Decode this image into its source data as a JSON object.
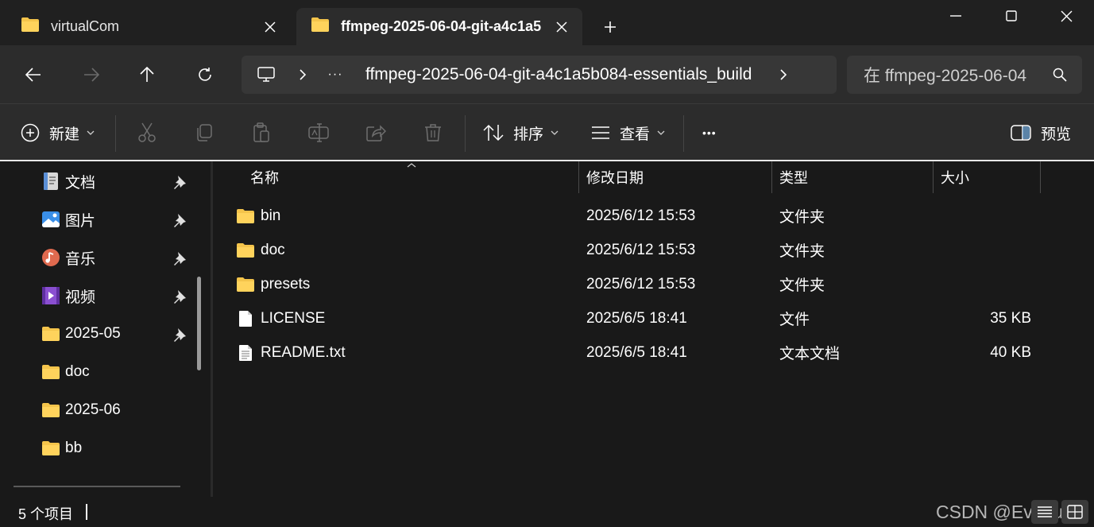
{
  "tabs": [
    {
      "title": "virtualCom",
      "active": false
    },
    {
      "title": "ffmpeg-2025-06-04-git-a4c1a5",
      "active": true
    }
  ],
  "address": {
    "path": "ffmpeg-2025-06-04-git-a4c1a5b084-essentials_build",
    "ellipsis": "···",
    "search_placeholder": "在 ffmpeg-2025-06-04"
  },
  "toolbar": {
    "new_label": "新建",
    "sort_label": "排序",
    "view_label": "查看",
    "more_label": "•••",
    "preview_label": "预览"
  },
  "sidebar": {
    "items": [
      {
        "label": "文档",
        "icon": "document-icon",
        "pinned": true
      },
      {
        "label": "图片",
        "icon": "picture-icon",
        "pinned": true
      },
      {
        "label": "音乐",
        "icon": "music-icon",
        "pinned": true
      },
      {
        "label": "视频",
        "icon": "video-icon",
        "pinned": true
      },
      {
        "label": "2025-05",
        "icon": "folder-icon",
        "pinned": true
      },
      {
        "label": "doc",
        "icon": "folder-icon",
        "pinned": false
      },
      {
        "label": "2025-06",
        "icon": "folder-icon",
        "pinned": false
      },
      {
        "label": "bb",
        "icon": "folder-icon",
        "pinned": false
      }
    ]
  },
  "columns": {
    "name": "名称",
    "modified": "修改日期",
    "type": "类型",
    "size": "大小"
  },
  "files": [
    {
      "name": "bin",
      "modified": "2025/6/12 15:53",
      "type": "文件夹",
      "size": "",
      "icon": "folder-icon"
    },
    {
      "name": "doc",
      "modified": "2025/6/12 15:53",
      "type": "文件夹",
      "size": "",
      "icon": "folder-icon"
    },
    {
      "name": "presets",
      "modified": "2025/6/12 15:53",
      "type": "文件夹",
      "size": "",
      "icon": "folder-icon"
    },
    {
      "name": "LICENSE",
      "modified": "2025/6/5 18:41",
      "type": "文件",
      "size": "35 KB",
      "icon": "file-icon"
    },
    {
      "name": "README.txt",
      "modified": "2025/6/5 18:41",
      "type": "文本文档",
      "size": "40 KB",
      "icon": "text-file-icon"
    }
  ],
  "status": {
    "item_count": "5 个项目"
  },
  "watermark": "CSDN @Evenurs",
  "colors": {
    "folder": "#f4c44b",
    "background": "#191919",
    "toolbar": "#2c2c2c"
  }
}
